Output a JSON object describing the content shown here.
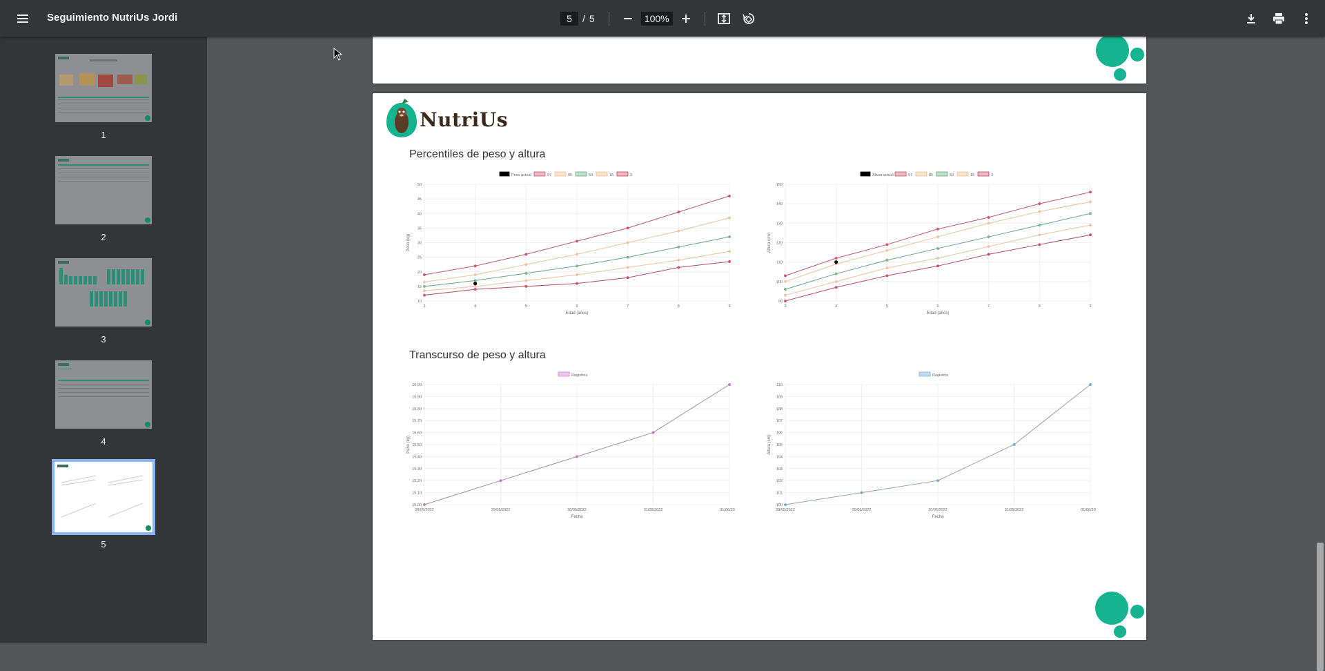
{
  "toolbar": {
    "title": "Seguimiento NutriUs Jordi",
    "page_current": "5",
    "page_separator": "/",
    "page_total": "5",
    "zoom": "100%"
  },
  "sidebar": {
    "pages": [
      {
        "label": "1"
      },
      {
        "label": "2"
      },
      {
        "label": "3"
      },
      {
        "label": "4"
      },
      {
        "label": "5"
      }
    ]
  },
  "page": {
    "brand": "NutriUs",
    "section_percentiles": "Percentiles de peso y altura",
    "section_transcurso": "Transcurso de peso y altura"
  },
  "colors": {
    "brand_green": "#15b38f",
    "p97": "#c0392b",
    "p85": "#e7b98a",
    "p50": "#3a9d5d",
    "p15": "#e7b98a",
    "p3": "#c0392b"
  },
  "chart_data": [
    {
      "type": "line",
      "legend": [
        "Peso actual",
        "97",
        "85",
        "50",
        "15",
        "3"
      ],
      "xlabel": "Edad (años)",
      "ylabel": "Peso (kg)",
      "x": [
        3,
        4,
        5,
        6,
        7,
        8,
        9
      ],
      "ylim": [
        10,
        50
      ],
      "yticks": [
        10,
        15,
        20,
        25,
        30,
        35,
        40,
        45,
        50
      ],
      "series": [
        {
          "name": "97",
          "values": [
            19,
            22,
            26,
            30.5,
            35,
            40.5,
            46
          ]
        },
        {
          "name": "85",
          "values": [
            16.5,
            19,
            22.5,
            26,
            30,
            34,
            38.5
          ]
        },
        {
          "name": "50",
          "values": [
            15,
            17,
            19.5,
            22,
            25,
            28.5,
            32
          ]
        },
        {
          "name": "15",
          "values": [
            13.5,
            15,
            17,
            19,
            21.5,
            24,
            27
          ]
        },
        {
          "name": "3",
          "values": [
            12,
            14,
            15,
            16,
            18,
            21.5,
            23.5
          ]
        }
      ],
      "current": {
        "name": "Peso actual",
        "x": 4,
        "y": 16
      }
    },
    {
      "type": "line",
      "legend": [
        "Altura actual",
        "97",
        "85",
        "50",
        "15",
        "3"
      ],
      "xlabel": "Edad (años)",
      "ylabel": "Altura (cm)",
      "x": [
        3,
        4,
        5,
        6,
        7,
        8,
        9
      ],
      "ylim": [
        90,
        150
      ],
      "yticks": [
        90,
        100,
        110,
        120,
        130,
        140,
        150
      ],
      "series": [
        {
          "name": "97",
          "values": [
            103,
            112,
            119,
            127,
            133,
            140,
            146
          ]
        },
        {
          "name": "85",
          "values": [
            100,
            109,
            116,
            123,
            130,
            136,
            141
          ]
        },
        {
          "name": "50",
          "values": [
            96,
            104,
            111,
            117,
            123,
            129,
            135
          ]
        },
        {
          "name": "15",
          "values": [
            93,
            100,
            107,
            112,
            118,
            124,
            129
          ]
        },
        {
          "name": "3",
          "values": [
            90,
            97,
            103,
            108,
            114,
            119,
            124
          ]
        }
      ],
      "current": {
        "name": "Altura actual",
        "x": 4,
        "y": 110
      }
    },
    {
      "type": "line",
      "legend": [
        "Registros"
      ],
      "xlabel": "Fecha",
      "ylabel": "Peso (kg)",
      "categories": [
        "28/05/2022",
        "29/05/2022",
        "30/05/2022",
        "31/05/2022",
        "01/06/2022"
      ],
      "ylim": [
        15.0,
        16.0
      ],
      "yticks": [
        "15,00",
        "15,10",
        "15,20",
        "15,30",
        "15,40",
        "15,50",
        "15,60",
        "15,70",
        "15,80",
        "15,90",
        "16,00"
      ],
      "series": [
        {
          "name": "Registros",
          "values": [
            15.0,
            15.2,
            15.4,
            15.6,
            16.0
          ]
        }
      ]
    },
    {
      "type": "line",
      "legend": [
        "Registros"
      ],
      "xlabel": "Fecha",
      "ylabel": "Altura (cm)",
      "categories": [
        "28/05/2022",
        "29/05/2022",
        "30/05/2022",
        "31/05/2022",
        "01/06/2022"
      ],
      "ylim": [
        100,
        110
      ],
      "yticks": [
        100,
        101,
        102,
        103,
        104,
        105,
        106,
        107,
        108,
        109,
        110
      ],
      "series": [
        {
          "name": "Registros",
          "values": [
            100,
            101,
            102,
            105,
            110
          ]
        }
      ]
    }
  ]
}
